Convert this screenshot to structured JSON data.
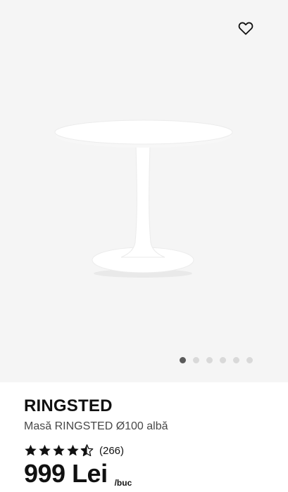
{
  "product": {
    "name": "RINGSTED",
    "description": "Masă RINGSTED Ø100 albă",
    "rating": {
      "value": 4.5,
      "max": 5,
      "count_label": "(266)"
    },
    "price": "999 Lei",
    "unit": "/buc"
  },
  "gallery": {
    "image_count": 6,
    "active_index": 0,
    "favorite_icon": "heart-outline-icon"
  },
  "colors": {
    "gallery_bg": "#f5f5f5",
    "dot_active": "#5a5a5a",
    "dot_inactive": "#d9d9d9",
    "text": "#111111",
    "text_secondary": "#484848"
  }
}
